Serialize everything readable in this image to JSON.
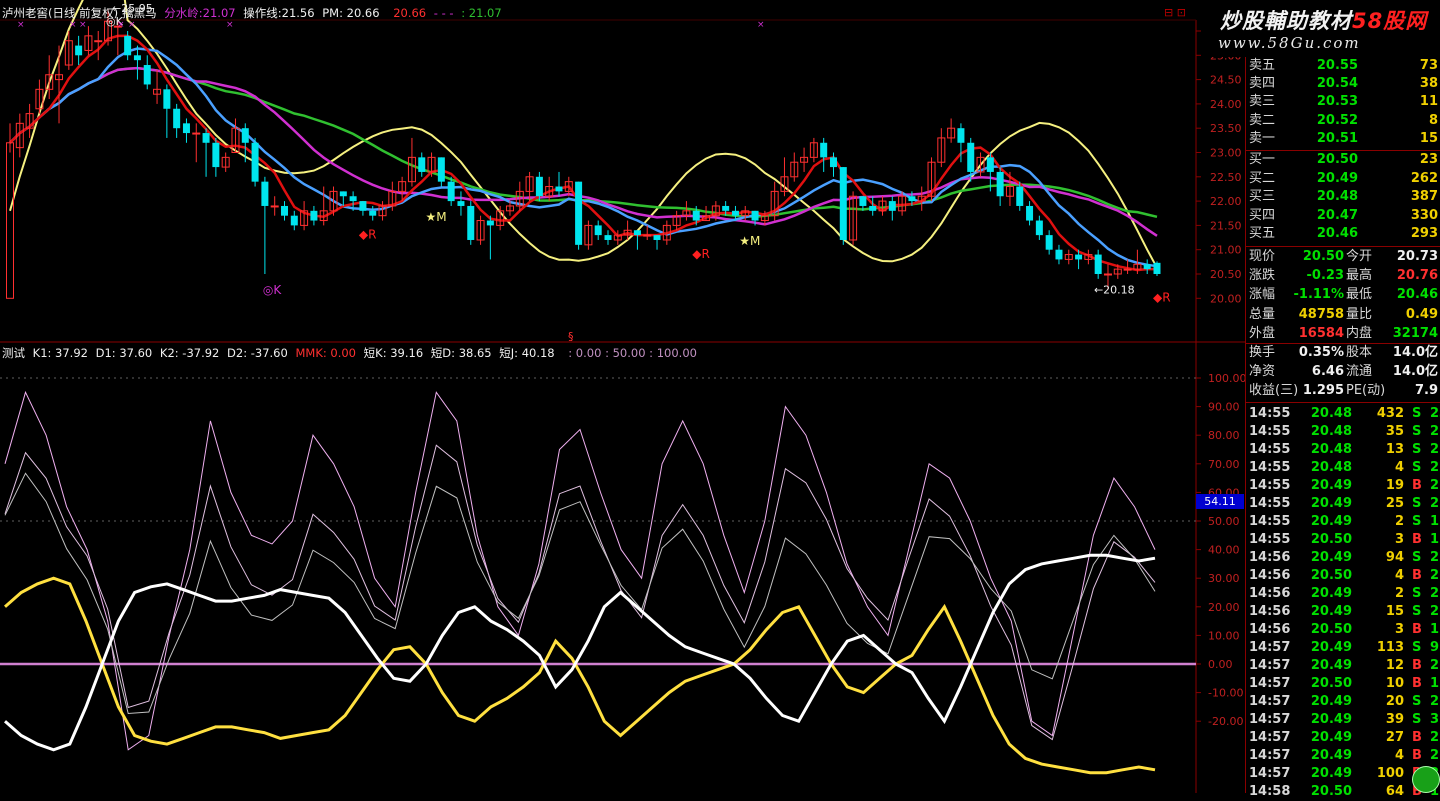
{
  "header": {
    "stock": "泸州老窖(日线 前复权)",
    "indicator": "擒黑马",
    "fenshui_label": "分水岭:",
    "fenshui_value": "21.07",
    "caozuo_label": "操作线:",
    "caozuo_value": "21.56",
    "pm": "PM: 20.66",
    "val3": "20.66",
    "dashes": "- - -",
    "val4": ": 21.07"
  },
  "indicator_bar": {
    "name": "测试",
    "k1": "K1: 37.92",
    "d1": "D1: 37.60",
    "k2": "K2: -37.92",
    "d2": "D2: -37.60",
    "mmk": "MMK: 0.00",
    "dk": "短K: 39.16",
    "dd": "短D: 38.65",
    "dj": "短J: 40.18",
    "tail": ": 0.00 : 50.00 : 100.00"
  },
  "price_axis": [
    "25.50",
    "25.00",
    "24.50",
    "24.00",
    "23.50",
    "23.00",
    "22.50",
    "22.00",
    "21.50",
    "21.00",
    "20.50",
    "20.00"
  ],
  "ind_axis": [
    "100.00",
    "90.00",
    "80.00",
    "70.00",
    "60.00",
    "50.00",
    "40.00",
    "30.00",
    "20.00",
    "10.00",
    "0.00",
    "-10.00",
    "-20.00"
  ],
  "float_label": "54.11",
  "annotations": {
    "high": "25.95",
    "low": "20.18",
    "k_top": "◎K",
    "k_low": "◎K",
    "r_mark": "◆R",
    "m_mark": "★M",
    "s_mark": "§"
  },
  "banner": {
    "line1_prefix": "炒股輔助教材",
    "line1_site": "58股网",
    "line2": "www.58Gu.com"
  },
  "order_book": {
    "asks": [
      {
        "label": "卖五",
        "price": "20.55",
        "vol": "73"
      },
      {
        "label": "卖四",
        "price": "20.54",
        "vol": "38"
      },
      {
        "label": "卖三",
        "price": "20.53",
        "vol": "11"
      },
      {
        "label": "卖二",
        "price": "20.52",
        "vol": "8"
      },
      {
        "label": "卖一",
        "price": "20.51",
        "vol": "15"
      }
    ],
    "bids": [
      {
        "label": "买一",
        "price": "20.50",
        "vol": "23"
      },
      {
        "label": "买二",
        "price": "20.49",
        "vol": "262"
      },
      {
        "label": "买三",
        "price": "20.48",
        "vol": "387"
      },
      {
        "label": "买四",
        "price": "20.47",
        "vol": "330"
      },
      {
        "label": "买五",
        "price": "20.46",
        "vol": "293"
      }
    ]
  },
  "quote": [
    {
      "l1": "现价",
      "v1": "20.50",
      "c1": "#00e000",
      "l2": "今开",
      "v2": "20.73",
      "c2": "#f0f0f0"
    },
    {
      "l1": "涨跌",
      "v1": "-0.23",
      "c1": "#00e000",
      "l2": "最高",
      "v2": "20.76",
      "c2": "#ff3030"
    },
    {
      "l1": "涨幅",
      "v1": "-1.11%",
      "c1": "#00e000",
      "l2": "最低",
      "v2": "20.46",
      "c2": "#00e000"
    },
    {
      "l1": "总量",
      "v1": "48758",
      "c1": "#f0d000",
      "l2": "量比",
      "v2": "0.49",
      "c2": "#f0d000"
    },
    {
      "l1": "外盘",
      "v1": "16584",
      "c1": "#ff3030",
      "l2": "内盘",
      "v2": "32174",
      "c2": "#00e000"
    },
    {
      "l1": "换手",
      "v1": "0.35%",
      "c1": "#f0f0f0",
      "l2": "股本",
      "v2": "14.0亿",
      "c2": "#f0f0f0"
    },
    {
      "l1": "净资",
      "v1": "6.46",
      "c1": "#f0f0f0",
      "l2": "流通",
      "v2": "14.0亿",
      "c2": "#f0f0f0"
    },
    {
      "l1": "收益(三)",
      "v1": "1.295",
      "c1": "#f0f0f0",
      "l2": "PE(动)",
      "v2": "7.9",
      "c2": "#f0f0f0"
    }
  ],
  "ticks": [
    {
      "time": "14:55",
      "price": "20.48",
      "vol": "432",
      "side": "S",
      "n": "23"
    },
    {
      "time": "14:55",
      "price": "20.48",
      "vol": "35",
      "side": "S",
      "n": "2"
    },
    {
      "time": "14:55",
      "price": "20.48",
      "vol": "13",
      "side": "S",
      "n": "2"
    },
    {
      "time": "14:55",
      "price": "20.48",
      "vol": "4",
      "side": "S",
      "n": "2"
    },
    {
      "time": "14:55",
      "price": "20.49",
      "vol": "19",
      "side": "B",
      "n": "2"
    },
    {
      "time": "14:55",
      "price": "20.49",
      "vol": "25",
      "side": "S",
      "n": "2"
    },
    {
      "time": "14:55",
      "price": "20.49",
      "vol": "2",
      "side": "S",
      "n": "1"
    },
    {
      "time": "14:55",
      "price": "20.50",
      "vol": "3",
      "side": "B",
      "n": "1"
    },
    {
      "time": "14:56",
      "price": "20.49",
      "vol": "94",
      "side": "S",
      "n": "2"
    },
    {
      "time": "14:56",
      "price": "20.50",
      "vol": "4",
      "side": "B",
      "n": "2"
    },
    {
      "time": "14:56",
      "price": "20.49",
      "vol": "2",
      "side": "S",
      "n": "2"
    },
    {
      "time": "14:56",
      "price": "20.49",
      "vol": "15",
      "side": "S",
      "n": "2"
    },
    {
      "time": "14:56",
      "price": "20.50",
      "vol": "3",
      "side": "B",
      "n": "1"
    },
    {
      "time": "14:57",
      "price": "20.49",
      "vol": "113",
      "side": "S",
      "n": "9"
    },
    {
      "time": "14:57",
      "price": "20.49",
      "vol": "12",
      "side": "B",
      "n": "2"
    },
    {
      "time": "14:57",
      "price": "20.50",
      "vol": "10",
      "side": "B",
      "n": "1"
    },
    {
      "time": "14:57",
      "price": "20.49",
      "vol": "20",
      "side": "S",
      "n": "2"
    },
    {
      "time": "14:57",
      "price": "20.49",
      "vol": "39",
      "side": "S",
      "n": "3"
    },
    {
      "time": "14:57",
      "price": "20.49",
      "vol": "27",
      "side": "B",
      "n": "2"
    },
    {
      "time": "14:57",
      "price": "20.49",
      "vol": "4",
      "side": "B",
      "n": "2"
    },
    {
      "time": "14:57",
      "price": "20.49",
      "vol": "100",
      "side": "B",
      "n": "2"
    },
    {
      "time": "14:58",
      "price": "20.50",
      "vol": "64",
      "side": "B",
      "n": "1"
    }
  ],
  "colors": {
    "up": "#ff3030",
    "down": "#00e5ee",
    "ma_red": "#e01010",
    "ma_blue": "#4aa0ff",
    "ma_magenta": "#d030d0",
    "ma_green": "#30c030",
    "band_yellow": "#f5f080",
    "k_white": "#ffffff",
    "k_yellow": "#ffe040",
    "zero": "#d080d0"
  },
  "candles": [
    [
      20.0,
      23.2,
      23.0,
      23.6
    ],
    [
      23.1,
      23.6,
      22.9,
      23.8
    ],
    [
      23.5,
      23.8,
      23.3,
      24.0
    ],
    [
      23.9,
      24.3,
      23.8,
      24.5
    ],
    [
      24.3,
      24.6,
      24.1,
      25.0
    ],
    [
      24.5,
      24.6,
      23.6,
      25.2
    ],
    [
      24.8,
      25.3,
      24.7,
      25.5
    ],
    [
      25.2,
      25.0,
      24.8,
      25.4
    ],
    [
      25.1,
      25.4,
      25.0,
      25.6
    ],
    [
      25.3,
      25.3,
      24.9,
      25.5
    ],
    [
      25.3,
      25.7,
      25.2,
      25.95
    ],
    [
      25.6,
      25.6,
      25.0,
      25.7
    ],
    [
      25.4,
      25.0,
      24.9,
      25.5
    ],
    [
      25.0,
      24.9,
      24.5,
      25.2
    ],
    [
      24.8,
      24.4,
      24.3,
      25.0
    ],
    [
      24.2,
      24.3,
      24.0,
      24.7
    ],
    [
      24.3,
      23.9,
      23.3,
      24.4
    ],
    [
      23.9,
      23.5,
      23.3,
      24.0
    ],
    [
      23.6,
      23.4,
      23.2,
      23.7
    ],
    [
      23.4,
      23.4,
      22.8,
      23.6
    ],
    [
      23.4,
      23.2,
      22.5,
      23.5
    ],
    [
      23.2,
      22.7,
      22.5,
      23.3
    ],
    [
      22.7,
      22.9,
      22.6,
      23.0
    ],
    [
      23.0,
      23.5,
      23.0,
      23.7
    ],
    [
      23.5,
      23.2,
      22.8,
      23.6
    ],
    [
      23.2,
      22.4,
      22.3,
      23.3
    ],
    [
      22.4,
      21.9,
      20.5,
      22.5
    ],
    [
      21.9,
      21.9,
      21.7,
      22.1
    ],
    [
      21.9,
      21.7,
      21.6,
      22.0
    ],
    [
      21.7,
      21.5,
      21.4,
      21.8
    ],
    [
      21.5,
      21.8,
      21.4,
      22.0
    ],
    [
      21.8,
      21.6,
      21.5,
      21.9
    ],
    [
      21.6,
      21.8,
      21.5,
      22.3
    ],
    [
      21.8,
      22.2,
      21.7,
      22.3
    ],
    [
      22.2,
      22.1,
      21.9,
      22.2
    ],
    [
      22.1,
      22.0,
      21.8,
      22.2
    ],
    [
      22.0,
      21.8,
      21.7,
      22.0
    ],
    [
      21.8,
      21.7,
      21.6,
      21.9
    ],
    [
      21.7,
      21.9,
      21.6,
      22.0
    ],
    [
      21.9,
      22.2,
      21.8,
      22.4
    ],
    [
      22.2,
      22.4,
      22.0,
      22.5
    ],
    [
      22.4,
      22.9,
      22.3,
      23.3
    ],
    [
      22.9,
      22.6,
      22.5,
      23.0
    ],
    [
      22.6,
      22.9,
      22.5,
      23.0
    ],
    [
      22.9,
      22.4,
      22.3,
      22.9
    ],
    [
      22.4,
      22.0,
      21.9,
      22.5
    ],
    [
      22.0,
      21.9,
      21.7,
      22.2
    ],
    [
      21.9,
      21.2,
      21.1,
      22.0
    ],
    [
      21.2,
      21.6,
      21.1,
      21.7
    ],
    [
      21.6,
      21.5,
      20.8,
      21.7
    ],
    [
      21.5,
      21.8,
      21.4,
      21.9
    ],
    [
      21.8,
      21.9,
      21.7,
      22.0
    ],
    [
      21.9,
      22.2,
      21.8,
      22.4
    ],
    [
      22.2,
      22.5,
      22.0,
      22.6
    ],
    [
      22.5,
      22.1,
      22.0,
      22.6
    ],
    [
      22.1,
      22.3,
      22.0,
      22.5
    ],
    [
      22.3,
      22.2,
      22.1,
      22.6
    ],
    [
      22.2,
      22.4,
      22.1,
      22.5
    ],
    [
      22.4,
      21.1,
      21.0,
      22.4
    ],
    [
      21.1,
      21.5,
      21.0,
      21.6
    ],
    [
      21.5,
      21.3,
      21.2,
      21.6
    ],
    [
      21.3,
      21.2,
      21.1,
      21.4
    ],
    [
      21.2,
      21.3,
      21.1,
      21.4
    ],
    [
      21.3,
      21.4,
      21.2,
      21.6
    ],
    [
      21.4,
      21.3,
      21.0,
      21.4
    ],
    [
      21.3,
      21.3,
      21.2,
      21.5
    ],
    [
      21.3,
      21.2,
      21.0,
      21.3
    ],
    [
      21.2,
      21.5,
      21.1,
      21.6
    ],
    [
      21.5,
      21.7,
      21.4,
      21.8
    ],
    [
      21.7,
      21.8,
      21.6,
      22.0
    ],
    [
      21.8,
      21.6,
      21.5,
      21.9
    ],
    [
      21.6,
      21.7,
      21.6,
      21.9
    ],
    [
      21.7,
      21.9,
      21.6,
      22.0
    ],
    [
      21.9,
      21.8,
      21.7,
      22.0
    ],
    [
      21.8,
      21.7,
      21.6,
      21.9
    ],
    [
      21.7,
      21.8,
      21.6,
      21.9
    ],
    [
      21.8,
      21.6,
      21.5,
      21.8
    ],
    [
      21.6,
      21.7,
      21.5,
      21.8
    ],
    [
      21.7,
      22.2,
      21.6,
      22.4
    ],
    [
      22.2,
      22.5,
      22.1,
      22.9
    ],
    [
      22.5,
      22.8,
      22.4,
      23.0
    ],
    [
      22.8,
      22.9,
      22.6,
      23.1
    ],
    [
      22.9,
      23.2,
      22.8,
      23.3
    ],
    [
      23.2,
      22.9,
      22.6,
      23.3
    ],
    [
      22.9,
      22.7,
      22.5,
      23.0
    ],
    [
      22.7,
      21.2,
      21.1,
      22.7
    ],
    [
      21.2,
      22.1,
      21.1,
      22.2
    ],
    [
      22.1,
      21.9,
      21.8,
      22.1
    ],
    [
      21.9,
      21.8,
      21.7,
      22.1
    ],
    [
      21.8,
      22.0,
      21.7,
      22.1
    ],
    [
      22.0,
      21.8,
      21.6,
      22.1
    ],
    [
      21.8,
      22.1,
      21.7,
      22.2
    ],
    [
      22.1,
      22.0,
      21.9,
      22.2
    ],
    [
      22.0,
      22.1,
      21.8,
      22.3
    ],
    [
      22.1,
      22.8,
      22.0,
      22.9
    ],
    [
      22.8,
      23.3,
      22.7,
      23.5
    ],
    [
      23.3,
      23.5,
      23.2,
      23.7
    ],
    [
      23.5,
      23.2,
      22.8,
      23.6
    ],
    [
      23.2,
      22.6,
      22.4,
      23.3
    ],
    [
      22.6,
      22.9,
      22.5,
      23.0
    ],
    [
      22.9,
      22.6,
      22.2,
      23.0
    ],
    [
      22.6,
      22.1,
      21.9,
      22.7
    ],
    [
      22.1,
      22.3,
      21.9,
      22.6
    ],
    [
      22.3,
      21.9,
      21.8,
      22.4
    ],
    [
      21.9,
      21.6,
      21.5,
      22.0
    ],
    [
      21.6,
      21.3,
      21.2,
      21.7
    ],
    [
      21.3,
      21.0,
      20.9,
      21.4
    ],
    [
      21.0,
      20.8,
      20.7,
      21.1
    ],
    [
      20.8,
      20.9,
      20.7,
      21.0
    ],
    [
      20.9,
      20.8,
      20.6,
      21.0
    ],
    [
      20.8,
      20.9,
      20.7,
      21.0
    ],
    [
      20.9,
      20.5,
      20.4,
      21.0
    ],
    [
      20.5,
      20.5,
      20.18,
      20.7
    ],
    [
      20.5,
      20.6,
      20.4,
      20.7
    ],
    [
      20.6,
      20.6,
      20.5,
      20.8
    ],
    [
      20.6,
      20.7,
      20.5,
      21.0
    ],
    [
      20.7,
      20.6,
      20.5,
      20.8
    ],
    [
      20.73,
      20.5,
      20.46,
      20.76
    ]
  ]
}
